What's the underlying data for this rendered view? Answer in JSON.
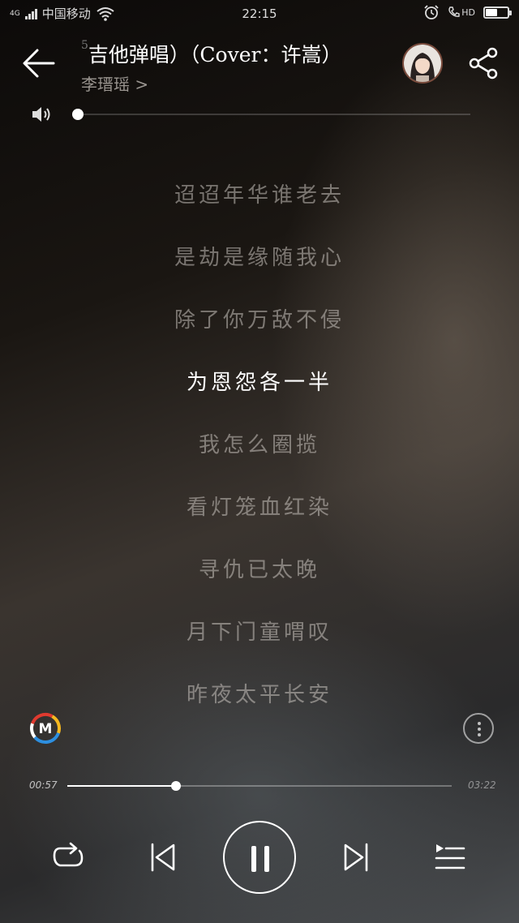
{
  "status_bar": {
    "network": "4G",
    "carrier": "中国移动",
    "time": "22:15",
    "hd_label": "HD",
    "battery_level": 0.55,
    "icons": [
      "signal-icon",
      "wifi-icon",
      "alarm-icon",
      "volte-call-icon",
      "battery-icon"
    ]
  },
  "header": {
    "title": "吉他弹唱）（Cover：许嵩）",
    "title_prefix": "5",
    "artist": "李瑨瑶 >",
    "back_icon": "arrow-left-icon",
    "share_icon": "share-icon"
  },
  "volume": {
    "level": 0.0,
    "icon": "speaker-icon"
  },
  "lyrics": {
    "lines": [
      {
        "text": "迢迢年华谁老去",
        "state": "normal"
      },
      {
        "text": "是劫是缘随我心",
        "state": "normal"
      },
      {
        "text": "除了你万敌不侵",
        "state": "normal"
      },
      {
        "text": "为恩怨各一半",
        "state": "active"
      },
      {
        "text": "我怎么圈揽",
        "state": "normal"
      },
      {
        "text": "看灯笼血红染",
        "state": "normal"
      },
      {
        "text": "寻仇已太晚",
        "state": "normal"
      },
      {
        "text": "月下门童喟叹",
        "state": "normal"
      },
      {
        "text": "昨夜太平长安",
        "state": "normal"
      }
    ]
  },
  "bottom_tools": {
    "logo_letter": "M",
    "logo_icon": "music-app-logo-icon",
    "more_icon": "more-vertical-icon",
    "logo_colors": [
      "#e03a2f",
      "#f5b820",
      "#2d8fe0",
      "#ffffff"
    ]
  },
  "progress": {
    "elapsed": "00:57",
    "total": "03:22",
    "fraction": 0.282
  },
  "controls": {
    "repeat_icon": "repeat-icon",
    "prev_icon": "skip-previous-icon",
    "play_state_icon": "pause-icon",
    "next_icon": "skip-next-icon",
    "playlist_icon": "playlist-icon"
  }
}
